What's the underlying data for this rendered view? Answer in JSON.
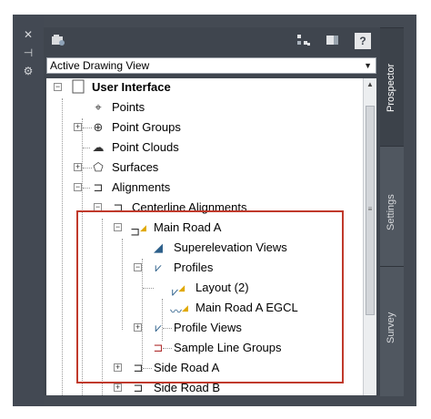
{
  "window_buttons": {
    "close": "✕",
    "pin": "⊣",
    "settings": "⚙"
  },
  "toolbar": {
    "left_icon": "prospector-icon",
    "icons": [
      "tree-view-icon",
      "item-view-icon",
      "help-icon"
    ],
    "help_label": "?"
  },
  "view_selector": {
    "value": "Active Drawing View"
  },
  "tree": {
    "root": "User Interface",
    "items": {
      "points": "Points",
      "point_groups": "Point Groups",
      "point_clouds": "Point Clouds",
      "surfaces": "Surfaces",
      "alignments": "Alignments",
      "centerline_alignments": "Centerline Alignments",
      "main_road_a": "Main Road A",
      "superelevation_views": "Superelevation Views",
      "profiles": "Profiles",
      "layout": "Layout (2)",
      "main_road_a_egcl": "Main Road A EGCL",
      "profile_views": "Profile Views",
      "sample_line_groups": "Sample Line Groups",
      "side_road_a": "Side Road A",
      "side_road_b": "Side Road B"
    }
  },
  "tabs": [
    "Prospector",
    "Settings",
    "Survey"
  ],
  "colors": {
    "highlight_box": "#c0392b",
    "panel": "#3f454e"
  }
}
